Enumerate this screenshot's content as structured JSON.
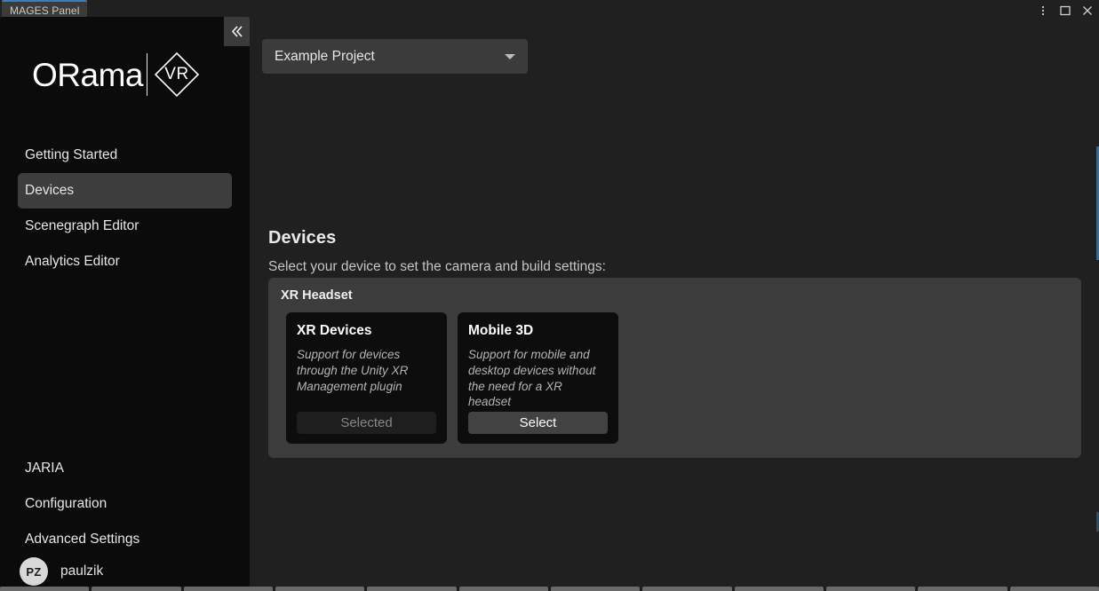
{
  "window": {
    "tab_label": "MAGES Panel",
    "controls": [
      {
        "name": "more-options-icon",
        "glyph": "kebab"
      },
      {
        "name": "maximize-icon",
        "glyph": "square"
      },
      {
        "name": "close-icon",
        "glyph": "x"
      }
    ],
    "accent_color": "#3A7EBF"
  },
  "sidebar": {
    "collapse_icon": "chevron-double-left-icon",
    "logo": {
      "word": "ORama",
      "badge": "VR"
    },
    "items_top": [
      {
        "label": "Getting Started",
        "active": false
      },
      {
        "label": "Devices",
        "active": true
      },
      {
        "label": "Scenegraph Editor",
        "active": false
      },
      {
        "label": "Analytics Editor",
        "active": false
      }
    ],
    "items_bottom": [
      {
        "label": "JARIA",
        "active": false
      },
      {
        "label": "Configuration",
        "active": false
      },
      {
        "label": "Advanced Settings",
        "active": false
      }
    ],
    "user": {
      "initials": "PZ",
      "name": "paulzik"
    },
    "background": "#0B0B0B",
    "active_item_background": "#3D3D3D"
  },
  "main": {
    "project_selector": {
      "value": "Example Project",
      "icon": "chevron-down-icon"
    },
    "page_title": "Devices",
    "page_subtitle": "Select your device to set the camera and build settings:",
    "group": {
      "title": "XR Headset",
      "background": "#3C3C3C",
      "cards": [
        {
          "title": "XR Devices",
          "description": "Support for devices through the Unity XR Management plugin",
          "button_label": "Selected",
          "selected": true
        },
        {
          "title": "Mobile 3D",
          "description": "Support for mobile and desktop devices without the need for a XR headset",
          "button_label": "Select",
          "selected": false
        }
      ]
    },
    "background": "#202020"
  }
}
